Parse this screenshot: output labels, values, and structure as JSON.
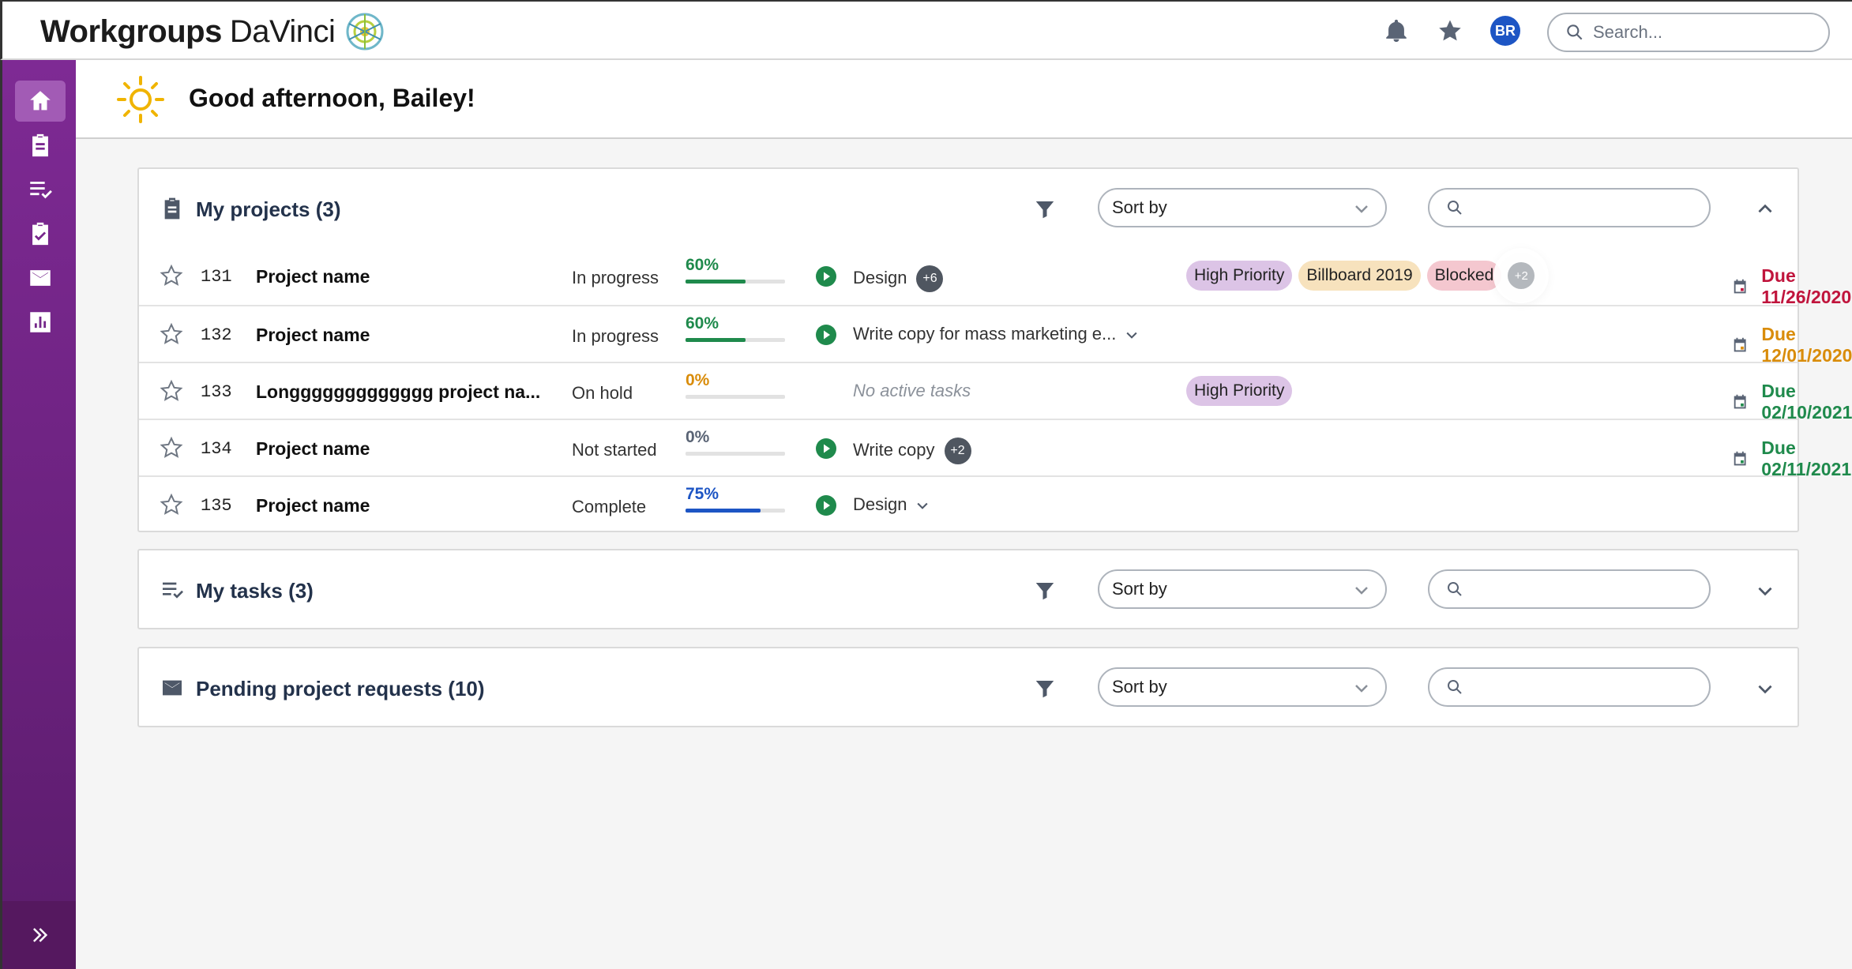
{
  "app": {
    "brand_main": "Workgroups",
    "brand_sub": "DaVinci",
    "user_initials": "BR",
    "search_placeholder": "Search...",
    "accent": "#7e2a94",
    "avatar_color": "#1d55c4"
  },
  "greeting": "Good afternoon, Bailey!",
  "sidebar": {
    "items": [
      {
        "name": "home",
        "icon": "home-icon",
        "active": true
      },
      {
        "name": "projects",
        "icon": "clipboard-icon",
        "active": false
      },
      {
        "name": "tasks",
        "icon": "task-list-icon",
        "active": false
      },
      {
        "name": "approvals",
        "icon": "clipboard-check-icon",
        "active": false
      },
      {
        "name": "requests",
        "icon": "mail-icon",
        "active": false
      },
      {
        "name": "reports",
        "icon": "bar-chart-icon",
        "active": false
      }
    ],
    "expand_icon": "double-chevron-right-icon"
  },
  "panels": {
    "projects": {
      "title": "My projects (3)",
      "sort_label": "Sort by",
      "expanded": true,
      "rows": [
        {
          "id": "131",
          "name": "Project name",
          "status": "In progress",
          "progress": "60%",
          "progress_value": 60,
          "progress_color": "#1f8a4c",
          "task": "Design",
          "task_count": "+6",
          "has_play": true,
          "tags": [
            "High Priority",
            "Billboard 2019",
            "Blocked"
          ],
          "tag_more": "+2",
          "due": "Due 11/26/2020",
          "due_color": "#c0143c"
        },
        {
          "id": "132",
          "name": "Project name",
          "status": "In progress",
          "progress": "60%",
          "progress_value": 60,
          "progress_color": "#1f8a4c",
          "task": "Write copy for mass marketing e...",
          "task_dropdown": true,
          "has_play": true,
          "tags": [],
          "due": "Due 12/01/2020",
          "due_color": "#d98c0a"
        },
        {
          "id": "133",
          "name": "Longgggggggggggg project na...",
          "status": "On hold",
          "progress": "0%",
          "progress_value": 0,
          "progress_color": "#d98c0a",
          "task": "No active tasks",
          "task_muted": true,
          "has_play": false,
          "tags": [
            "High Priority"
          ],
          "due": "Due 02/10/2021",
          "due_color": "#1f8a4c"
        },
        {
          "id": "134",
          "name": "Project name",
          "status": "Not started",
          "progress": "0%",
          "progress_value": 0,
          "progress_color": "#5a6475",
          "task": "Write copy",
          "task_count": "+2",
          "has_play": true,
          "tags": [],
          "due": "Due 02/11/2021",
          "due_color": "#1f8a4c"
        },
        {
          "id": "135",
          "name": "Project name",
          "status": "Complete",
          "progress": "75%",
          "progress_value": 75,
          "progress_color": "#1d55c4",
          "task": "Design",
          "task_dropdown": true,
          "has_play": true,
          "tags": [],
          "due": "",
          "due_color": ""
        }
      ]
    },
    "tasks": {
      "title": "My tasks (3)",
      "sort_label": "Sort by",
      "expanded": false
    },
    "requests": {
      "title": "Pending project requests (10)",
      "sort_label": "Sort by",
      "expanded": false
    }
  },
  "tag_colors": {
    "High Priority": "#dcc4e6",
    "Billboard 2019": "#f7e2bd",
    "Blocked": "#f4c7cf"
  }
}
